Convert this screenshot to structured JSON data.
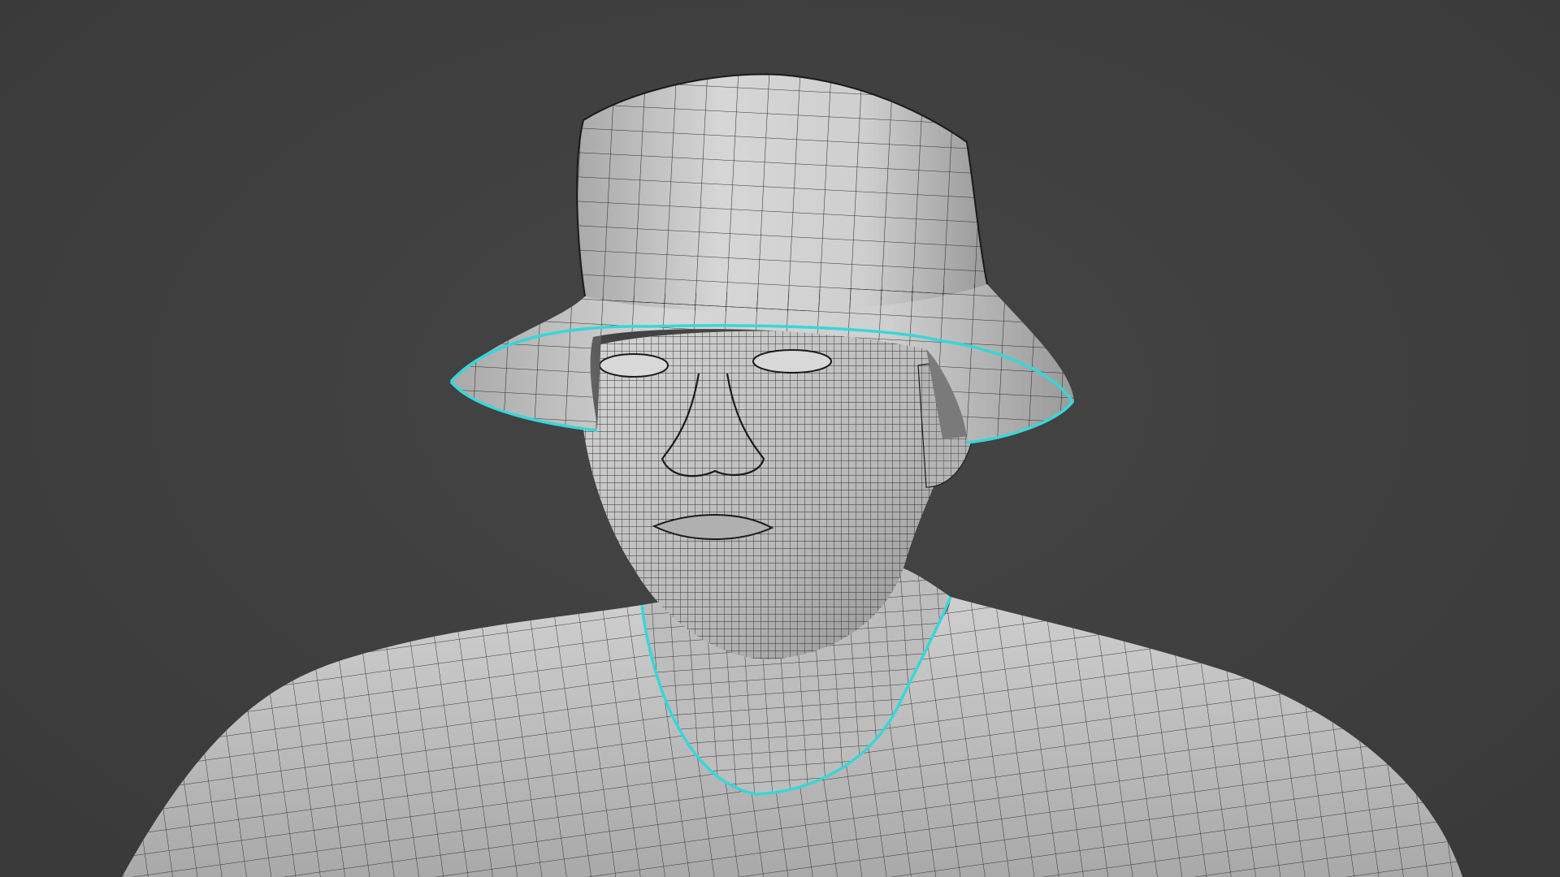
{
  "viewport": {
    "background_color": "#3d3d3d",
    "mode": "wireframe-overlay",
    "mesh_color": "#c9c9c9",
    "wire_color": "#1a1a1a",
    "selection_color": "#38d6d9"
  },
  "objects": [
    {
      "name": "bucket-hat",
      "icon": "mesh-icon"
    },
    {
      "name": "head",
      "icon": "mesh-icon"
    },
    {
      "name": "shirt",
      "icon": "mesh-icon"
    }
  ]
}
